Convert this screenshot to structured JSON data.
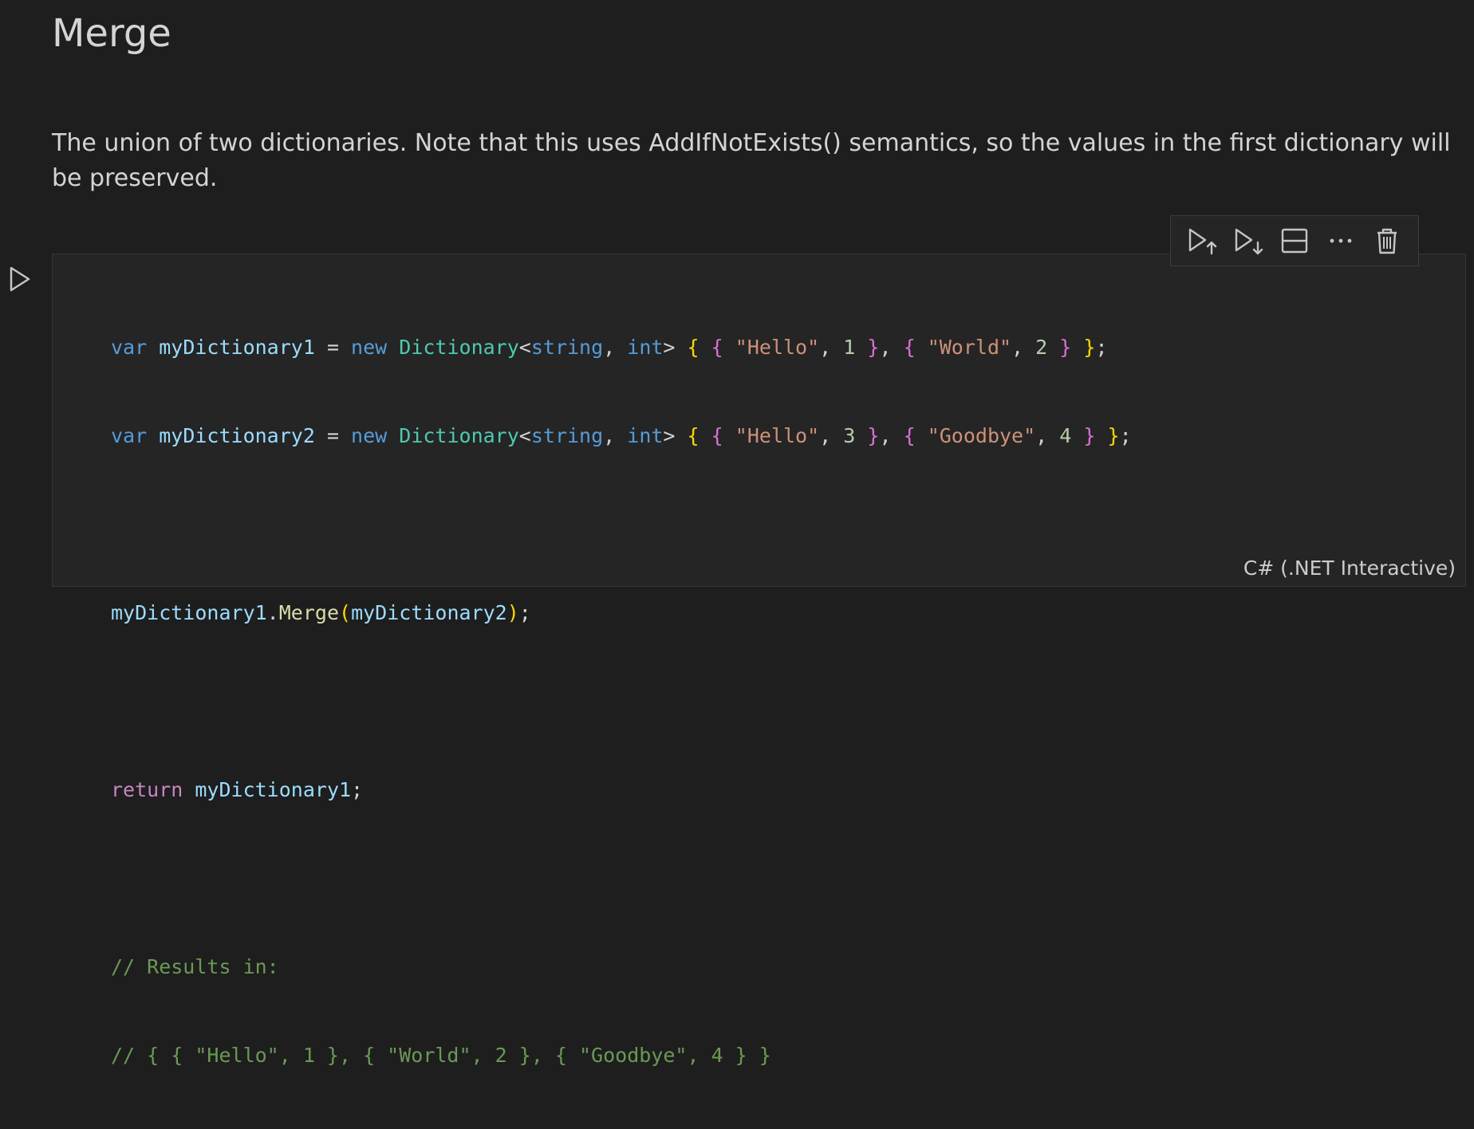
{
  "markdown": {
    "heading": "Merge",
    "description": "The union of two dictionaries. Note that this uses AddIfNotExists() semantics, so the values in the first dictionary will be preserved."
  },
  "cell": {
    "language": "C# (.NET Interactive)",
    "code": {
      "l1": {
        "var": "var",
        "name": "myDictionary1",
        "eq": " = ",
        "new": "new",
        "type": "Dictionary",
        "lt": "<",
        "t1": "string",
        "comma": ", ",
        "t2": "int",
        "gt": ">",
        "o1": "{",
        "o2": "{",
        "s1": "\"Hello\"",
        "c1": ", ",
        "n1": "1",
        "c2": "}",
        "c3": ", ",
        "o3": "{",
        "s2": "\"World\"",
        "c4": ", ",
        "n2": "2",
        "c5": "}",
        "c6": "}",
        "semi": ";"
      },
      "l2": {
        "var": "var",
        "name": "myDictionary2",
        "eq": " = ",
        "new": "new",
        "type": "Dictionary",
        "lt": "<",
        "t1": "string",
        "comma": ", ",
        "t2": "int",
        "gt": ">",
        "o1": "{",
        "o2": "{",
        "s1": "\"Hello\"",
        "c1": ", ",
        "n1": "3",
        "c2": "}",
        "c3": ", ",
        "o3": "{",
        "s2": "\"Goodbye\"",
        "c4": ", ",
        "n2": "4",
        "c5": "}",
        "c6": "}",
        "semi": ";"
      },
      "l4": {
        "obj": "myDictionary1",
        "dot": ".",
        "method": "Merge",
        "po": "(",
        "arg": "myDictionary2",
        "pc": ")",
        "semi": ";"
      },
      "l6": {
        "ret": "return",
        "name": "myDictionary1",
        "semi": ";"
      },
      "l8": "// Results in:",
      "l9": "// { { \"Hello\", 1 }, { \"World\", 2 }, { \"Goodbye\", 4 } }"
    }
  },
  "toolbar": {
    "icons": [
      "execute-above-icon",
      "execute-below-icon",
      "split-cell-icon",
      "more-actions-icon",
      "delete-cell-icon"
    ]
  },
  "gutter": {
    "icon": "run-cell-icon"
  }
}
